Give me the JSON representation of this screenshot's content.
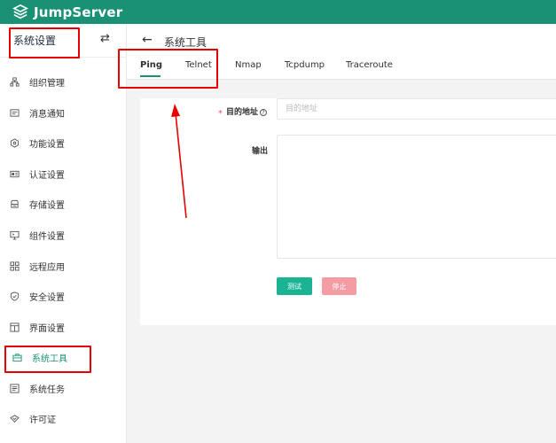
{
  "app": {
    "brand": "JumpServer"
  },
  "sidebar": {
    "title": "系统设置",
    "collapse_icon": "swap-arrows-icon",
    "items": [
      {
        "label": "组织管理",
        "icon": "org-tree-icon"
      },
      {
        "label": "消息通知",
        "icon": "message-icon"
      },
      {
        "label": "功能设置",
        "icon": "feature-hexagon-icon"
      },
      {
        "label": "认证设置",
        "icon": "id-card-icon"
      },
      {
        "label": "存储设置",
        "icon": "storage-icon"
      },
      {
        "label": "组件设置",
        "icon": "monitor-icon"
      },
      {
        "label": "远程应用",
        "icon": "apps-grid-icon"
      },
      {
        "label": "安全设置",
        "icon": "shield-icon"
      },
      {
        "label": "界面设置",
        "icon": "layout-icon"
      },
      {
        "label": "系统工具",
        "icon": "toolbox-icon",
        "active": true
      },
      {
        "label": "系统任务",
        "icon": "task-list-icon"
      },
      {
        "label": "许可证",
        "icon": "license-icon"
      }
    ]
  },
  "page": {
    "title": "系统工具",
    "tabs": [
      "Ping",
      "Telnet",
      "Nmap",
      "Tcpdump",
      "Traceroute"
    ],
    "active_tab": "Ping"
  },
  "form": {
    "target_label": "目的地址",
    "target_placeholder": "目的地址",
    "target_value": "",
    "output_label": "输出",
    "output_value": "",
    "test_button": "测试",
    "stop_button": "停止"
  },
  "colors": {
    "brand": "#1a9175",
    "primary_button": "#1ab394",
    "stop_button": "#f39ca4",
    "required": "#ed5565",
    "annotation": "#e60000"
  }
}
